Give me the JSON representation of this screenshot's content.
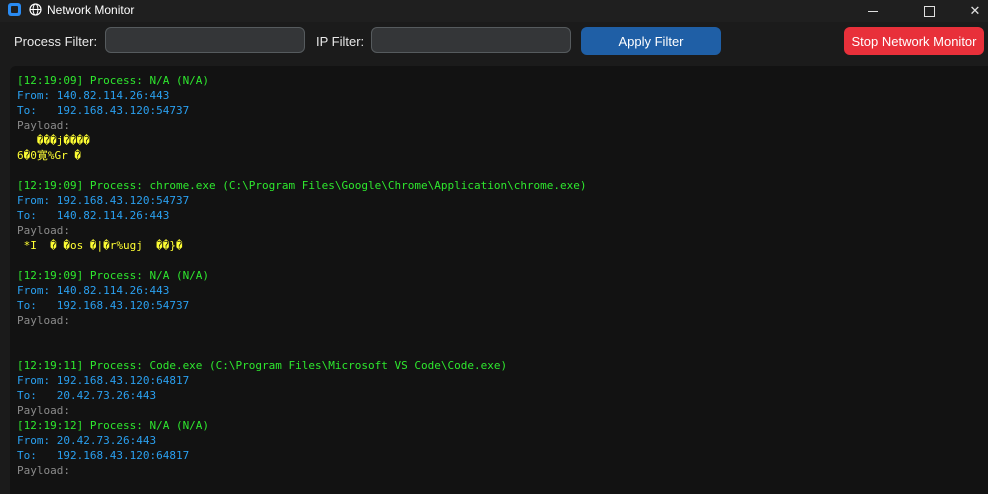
{
  "window": {
    "title": "Network Monitor",
    "controls": {
      "minimize": "",
      "maximize": "",
      "close": "✕"
    }
  },
  "toolbar": {
    "process_filter_label": "Process Filter:",
    "process_filter_value": "",
    "ip_filter_label": "IP Filter:",
    "ip_filter_value": "",
    "apply_label": "Apply Filter",
    "stop_label": "Stop Network Monitor"
  },
  "colors": {
    "process_line": "#2ee82e",
    "address_line": "#2aa0f0",
    "payload_label": "#8a8a8a",
    "payload_data": "#ffff33",
    "apply_button": "#1f5fa6",
    "stop_button": "#e8303a"
  },
  "log_lines": [
    {
      "text": "[12:19:09] Process: N/A (N/A)",
      "kind": "process"
    },
    {
      "text": "From: 140.82.114.26:443",
      "kind": "address"
    },
    {
      "text": "To:   192.168.43.120:54737",
      "kind": "address"
    },
    {
      "text": "Payload:",
      "kind": "payload_label"
    },
    {
      "text": "\u0017\u0003\u0003 \u0016  ���j����",
      "kind": "payload"
    },
    {
      "text": "6�0寛%Gr �",
      "kind": "payload"
    },
    {
      "text": "",
      "kind": "blank"
    },
    {
      "text": "[12:19:09] Process: chrome.exe (C:\\Program Files\\Google\\Chrome\\Application\\chrome.exe)",
      "kind": "process"
    },
    {
      "text": "From: 192.168.43.120:54737",
      "kind": "address"
    },
    {
      "text": "To:   140.82.114.26:443",
      "kind": "address"
    },
    {
      "text": "Payload:",
      "kind": "payload_label"
    },
    {
      "text": "\u0017\u0003\u0003 \u0001*I  �\u0001 �\u0012os �|�\u0014r\u0002%u\u0011gj  ��}�",
      "kind": "payload"
    },
    {
      "text": "",
      "kind": "blank"
    },
    {
      "text": "[12:19:09] Process: N/A (N/A)",
      "kind": "process"
    },
    {
      "text": "From: 140.82.114.26:443",
      "kind": "address"
    },
    {
      "text": "To:   192.168.43.120:54737",
      "kind": "address"
    },
    {
      "text": "Payload:",
      "kind": "payload_label"
    },
    {
      "text": "",
      "kind": "blank"
    },
    {
      "text": "",
      "kind": "blank"
    },
    {
      "text": "[12:19:11] Process: Code.exe (C:\\Program Files\\Microsoft VS Code\\Code.exe)",
      "kind": "process"
    },
    {
      "text": "From: 192.168.43.120:64817",
      "kind": "address"
    },
    {
      "text": "To:   20.42.73.26:443",
      "kind": "address"
    },
    {
      "text": "Payload:",
      "kind": "payload_label"
    },
    {
      "text": "[12:19:12] Process: N/A (N/A)",
      "kind": "process"
    },
    {
      "text": "From: 20.42.73.26:443",
      "kind": "address"
    },
    {
      "text": "To:   192.168.43.120:64817",
      "kind": "address"
    },
    {
      "text": "Payload:",
      "kind": "payload_label"
    }
  ]
}
